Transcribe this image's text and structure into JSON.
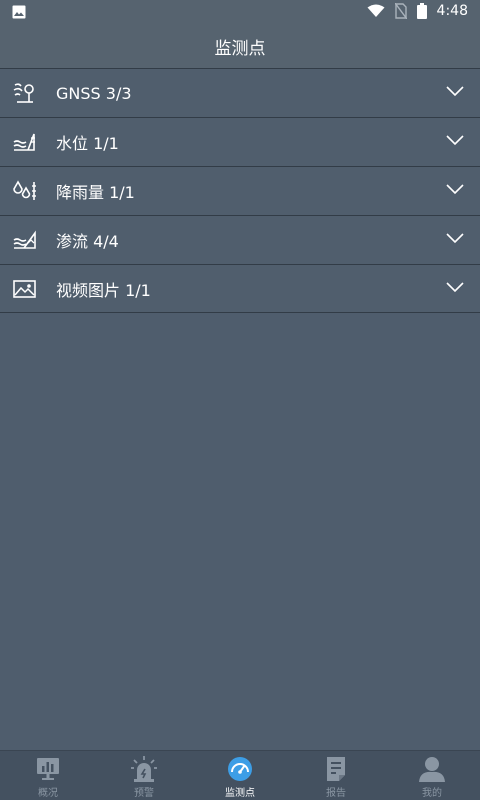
{
  "status_bar": {
    "time": "4:48"
  },
  "header": {
    "title": "监测点"
  },
  "list": [
    {
      "label": "GNSS 3/3",
      "icon": "gnss-icon"
    },
    {
      "label": "水位 1/1",
      "icon": "water-level-icon"
    },
    {
      "label": "降雨量 1/1",
      "icon": "rainfall-icon"
    },
    {
      "label": "渗流 4/4",
      "icon": "seepage-icon"
    },
    {
      "label": "视频图片 1/1",
      "icon": "image-icon"
    }
  ],
  "tabs": [
    {
      "label": "概况",
      "icon": "overview-icon",
      "active": false
    },
    {
      "label": "预警",
      "icon": "alarm-icon",
      "active": false
    },
    {
      "label": "监测点",
      "icon": "gauge-icon",
      "active": true
    },
    {
      "label": "报告",
      "icon": "report-icon",
      "active": false
    },
    {
      "label": "我的",
      "icon": "user-icon",
      "active": false
    }
  ],
  "colors": {
    "background": "#4f5d6d",
    "header": "#56636f",
    "divider": "#323c47",
    "tabbar": "#445160",
    "accent": "#3d9ee6"
  }
}
